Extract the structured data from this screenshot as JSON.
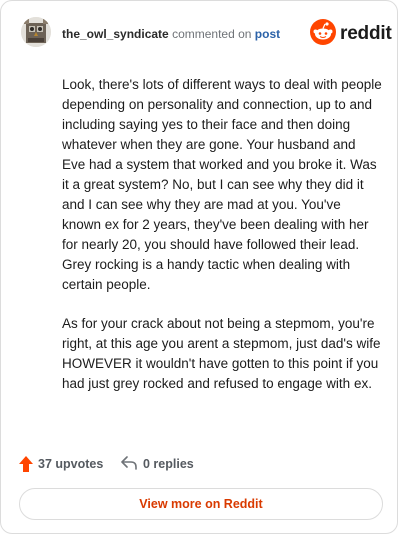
{
  "header": {
    "username": "the_owl_syndicate",
    "action_text": "commented on",
    "post_link_text": "post",
    "brand": "reddit"
  },
  "comment": {
    "paragraphs": [
      "Look, there's lots of different ways to deal with people depending on personality and connection, up to and including saying yes to their face and then doing whatever when they are gone. Your husband and Eve had a system that worked and you broke it. Was it a great system? No, but I can see why they did it and I can see why they are mad at you. You've known ex for 2 years, they've been dealing with her for nearly 20, you should have followed their lead. Grey rocking is a handy tactic when dealing with certain people.",
      "As for your crack about not being a stepmom, you're right, at this age you arent a stepmom, just dad's wife HOWEVER it wouldn't have gotten to this point if you had just grey rocked and refused to engage with ex."
    ]
  },
  "footer": {
    "upvotes_label": "37 upvotes",
    "replies_label": "0 replies",
    "upvote_icon": "upvote-arrow-icon",
    "reply_icon": "reply-arrow-icon"
  },
  "cta": {
    "label": "View more on Reddit"
  },
  "colors": {
    "brand_orange": "#ff4500",
    "link_blue": "#2b62a8",
    "cta_text": "#d93a00"
  }
}
